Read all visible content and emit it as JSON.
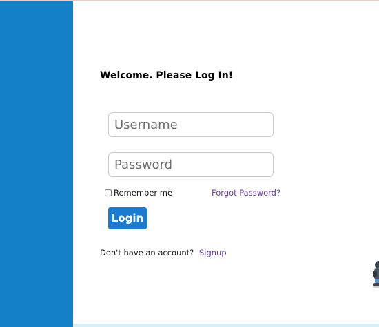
{
  "login": {
    "heading": "Welcome. Please Log In!",
    "username_placeholder": "Username",
    "username_value": "",
    "password_placeholder": "Password",
    "password_value": "",
    "remember_label": "Remember me",
    "remember_checked": false,
    "forgot_label": "Forgot Password?",
    "login_button": "Login",
    "signup_prompt": "Don't have an account?",
    "signup_link": "Signup"
  },
  "colors": {
    "sidebar": "#1380c8",
    "button": "#1a7bd1",
    "link": "#6a3d9a",
    "bottom_strip": "#d5f1f6"
  },
  "icons": {
    "mascot": "mascot-figure-icon"
  }
}
